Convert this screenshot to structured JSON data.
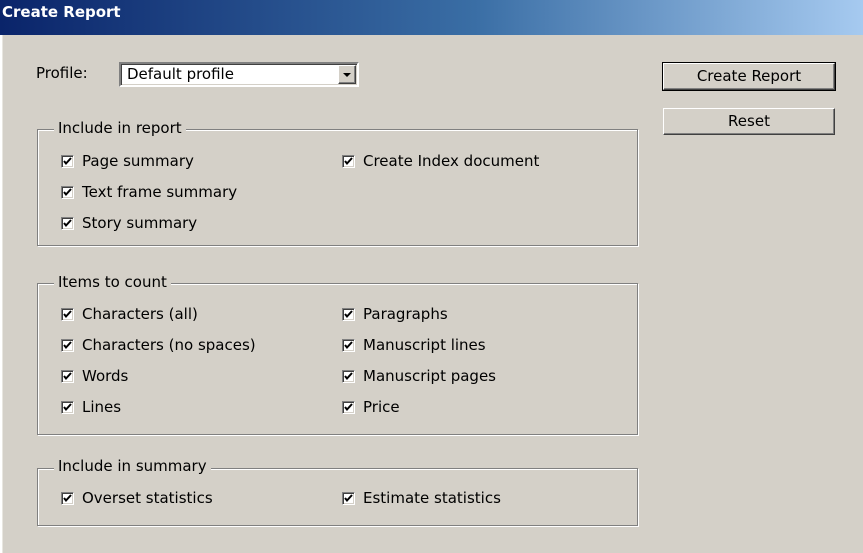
{
  "window": {
    "title": "Create Report"
  },
  "profile": {
    "label": "Profile:",
    "value": "Default profile"
  },
  "buttons": {
    "create_report": "Create Report",
    "reset": "Reset"
  },
  "groups": {
    "include_in_report": {
      "legend": "Include in report",
      "items": [
        {
          "label": "Page summary",
          "checked": true
        },
        {
          "label": "Text frame summary",
          "checked": true
        },
        {
          "label": "Story summary",
          "checked": true
        },
        {
          "label": "Create Index document",
          "checked": true
        }
      ]
    },
    "items_to_count": {
      "legend": "Items to count",
      "items": [
        {
          "label": "Characters (all)",
          "checked": true
        },
        {
          "label": "Characters (no spaces)",
          "checked": true
        },
        {
          "label": "Words",
          "checked": true
        },
        {
          "label": "Lines",
          "checked": true
        },
        {
          "label": "Paragraphs",
          "checked": true
        },
        {
          "label": "Manuscript lines",
          "checked": true
        },
        {
          "label": "Manuscript pages",
          "checked": true
        },
        {
          "label": "Price",
          "checked": true
        }
      ]
    },
    "include_in_summary": {
      "legend": "Include in summary",
      "items": [
        {
          "label": "Overset statistics",
          "checked": true
        },
        {
          "label": "Estimate statistics",
          "checked": true
        }
      ]
    }
  },
  "colors": {
    "titlebar_start": "#0a246a",
    "titlebar_end": "#a6caf0",
    "face": "#d4d0c8"
  }
}
